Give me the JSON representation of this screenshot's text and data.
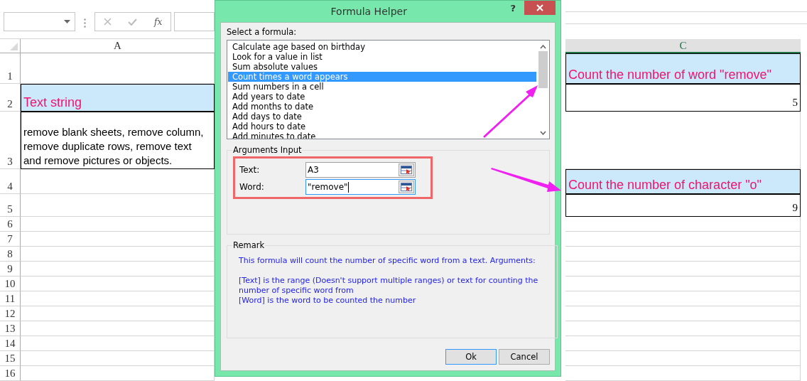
{
  "formula_bar": {
    "function_label": "fx"
  },
  "sheet": {
    "column_headers": [
      "A",
      "C"
    ],
    "rows": [
      {
        "number": "1",
        "c": {
          "kind": "heading",
          "text": "Count the number of word \"remove\""
        }
      },
      {
        "number": "2",
        "a": {
          "kind": "heading",
          "text": "Text string"
        },
        "c": {
          "kind": "number",
          "text": "5"
        }
      },
      {
        "number": "3",
        "a": {
          "kind": "text",
          "text": "remove blank sheets, remove column, remove duplicate rows, remove text and remove pictures or objects."
        }
      },
      {
        "number": "4",
        "c": {
          "kind": "heading",
          "text": "Count the number of character \"o\""
        }
      },
      {
        "number": "5",
        "c": {
          "kind": "number",
          "text": "9"
        }
      },
      {
        "number": "6"
      },
      {
        "number": "7"
      },
      {
        "number": "8"
      },
      {
        "number": "9"
      },
      {
        "number": "10"
      },
      {
        "number": "11"
      },
      {
        "number": "12"
      },
      {
        "number": "13"
      },
      {
        "number": "14"
      },
      {
        "number": "15"
      },
      {
        "number": "16"
      }
    ]
  },
  "dialog": {
    "title": "Formula Helper",
    "help_button": "?",
    "select_label": "Select a formula:",
    "formulas": [
      {
        "label": "Calculate age based on birthday",
        "selected": false
      },
      {
        "label": "Look for a value in list",
        "selected": false
      },
      {
        "label": "Sum absolute values",
        "selected": false
      },
      {
        "label": "Count times a word appears",
        "selected": true
      },
      {
        "label": "Sum numbers in a cell",
        "selected": false
      },
      {
        "label": "Add years to date",
        "selected": false
      },
      {
        "label": "Add months to date",
        "selected": false
      },
      {
        "label": "Add days to date",
        "selected": false
      },
      {
        "label": "Add hours to date",
        "selected": false
      },
      {
        "label": "Add minutes to date",
        "selected": false
      }
    ],
    "arguments": {
      "title": "Arguments Input",
      "fields": [
        {
          "label": "Text:",
          "value": "A3",
          "focused": false
        },
        {
          "label": "Word:",
          "value": "\"remove\"",
          "focused": true
        }
      ]
    },
    "remark": {
      "title": "Remark",
      "paragraphs": [
        "This formula will count the number of specific word from a text. Arguments:",
        "[Text] is the range (Doesn't support multiple ranges) or text for counting the number of specific word from",
        "[Word] is the word to be counted the number"
      ]
    },
    "buttons": [
      {
        "label": "Ok",
        "default": true
      },
      {
        "label": "Cancel",
        "default": false
      }
    ]
  }
}
